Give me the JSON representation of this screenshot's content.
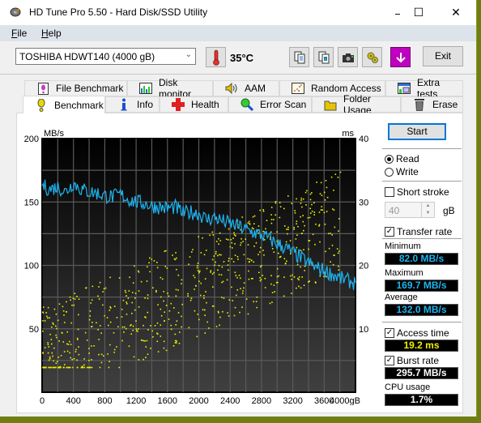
{
  "window": {
    "title": "HD Tune Pro 5.50 - Hard Disk/SSD Utility",
    "minimize": "—",
    "maximize": "☐",
    "close": "✕"
  },
  "menu": [
    {
      "label": "File",
      "accel": "F",
      "rest": "ile"
    },
    {
      "label": "Help",
      "accel": "H",
      "rest": "elp"
    }
  ],
  "toolbar": {
    "drive": "TOSHIBA HDWT140 (4000 gB)",
    "temperature": "35°C",
    "icons": [
      "copy-text-icon",
      "copy-image-icon",
      "screenshot-icon",
      "options-icon",
      "save-icon"
    ],
    "exit_label": "Exit"
  },
  "tabs_top": [
    {
      "label": "File Benchmark",
      "icon": "file-benchmark-icon"
    },
    {
      "label": "Disk monitor",
      "icon": "disk-monitor-icon"
    },
    {
      "label": "AAM",
      "icon": "speaker-icon"
    },
    {
      "label": "Random Access",
      "icon": "random-access-icon"
    },
    {
      "label": "Extra tests",
      "icon": "extra-tests-icon"
    }
  ],
  "tabs_bottom": [
    {
      "label": "Benchmark",
      "icon": "benchmark-icon",
      "active": true
    },
    {
      "label": "Info",
      "icon": "info-icon"
    },
    {
      "label": "Health",
      "icon": "health-icon"
    },
    {
      "label": "Error Scan",
      "icon": "magnifier-icon"
    },
    {
      "label": "Folder Usage",
      "icon": "folder-icon"
    },
    {
      "label": "Erase",
      "icon": "trash-icon"
    }
  ],
  "controls": {
    "start_label": "Start",
    "read_label": "Read",
    "write_label": "Write",
    "mode": "Read",
    "short_stroke_label": "Short stroke",
    "short_stroke_checked": false,
    "short_stroke_value": "40",
    "short_stroke_unit": "gB",
    "transfer_rate_label": "Transfer rate",
    "transfer_rate_checked": true,
    "minimum_label": "Minimum",
    "minimum_value": "82.0 MB/s",
    "maximum_label": "Maximum",
    "maximum_value": "169.7 MB/s",
    "average_label": "Average",
    "average_value": "132.0 MB/s",
    "access_time_label": "Access time",
    "access_time_checked": true,
    "access_time_value": "19.2 ms",
    "burst_rate_label": "Burst rate",
    "burst_rate_checked": true,
    "burst_rate_value": "295.7 MB/s",
    "cpu_usage_label": "CPU usage",
    "cpu_usage_value": "1.7%"
  },
  "colors": {
    "transfer_line": "#1eb4f0",
    "access_dots": "#f0f000",
    "stat_blue": "#1eb4f0",
    "stat_yellow": "#f0f000",
    "stat_white": "#ffffff"
  },
  "chart_data": {
    "type": "line",
    "title": "",
    "xlabel": "gB",
    "ylabel_left": "MB/s",
    "ylabel_right": "ms",
    "x_ticks": [
      "0",
      "400",
      "800",
      "1200",
      "1600",
      "2000",
      "2400",
      "2800",
      "3200",
      "3600",
      "4000gB"
    ],
    "y_left_ticks": [
      "50",
      "100",
      "150",
      "200"
    ],
    "y_right_ticks": [
      "10",
      "20",
      "30",
      "40"
    ],
    "xlim": [
      0,
      4000
    ],
    "ylim_left": [
      0,
      200
    ],
    "ylim_right": [
      0,
      40
    ],
    "grid": true,
    "series": [
      {
        "name": "Transfer rate (MB/s)",
        "axis": "left",
        "x": [
          0,
          100,
          200,
          300,
          400,
          500,
          600,
          700,
          800,
          900,
          1000,
          1100,
          1200,
          1300,
          1400,
          1500,
          1600,
          1700,
          1800,
          1900,
          2000,
          2100,
          2200,
          2300,
          2400,
          2500,
          2600,
          2700,
          2800,
          2900,
          3000,
          3100,
          3200,
          3300,
          3400,
          3500,
          3600,
          3700,
          3800,
          3900,
          4000
        ],
        "values": [
          163,
          160,
          162,
          158,
          165,
          160,
          158,
          157,
          155,
          154,
          156,
          152,
          150,
          149,
          147,
          146,
          145,
          146,
          141,
          142,
          141,
          136,
          138,
          135,
          133,
          131,
          128,
          126,
          124,
          121,
          117,
          114,
          110,
          106,
          102,
          98,
          96,
          93,
          90,
          88,
          86
        ]
      },
      {
        "name": "Access time (ms)",
        "axis": "right",
        "kind": "scatter",
        "range_ms": [
          4,
          35
        ],
        "average": 19.2
      }
    ]
  }
}
